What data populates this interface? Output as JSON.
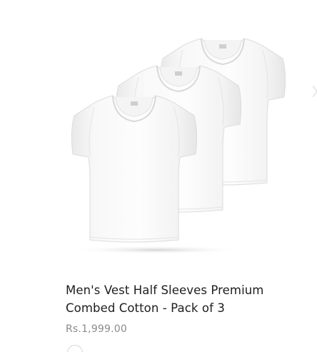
{
  "product": {
    "title_line1": "Men's Vest Half Sleeves Premium",
    "title_line2": "Combed Cotton - Pack of 3",
    "price": "Rs.1,999.00",
    "image_alt": "Pack of 3 white half sleeve vests",
    "swatch_color": "#ffffff"
  }
}
